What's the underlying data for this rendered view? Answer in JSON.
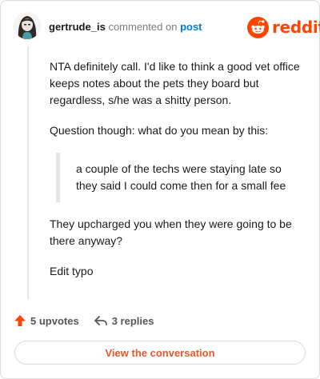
{
  "header": {
    "username": "gertrude_is",
    "commented_on": "commented on",
    "post_link": "post"
  },
  "brand": {
    "name": "reddit",
    "logo_icon": "reddit-alien-icon",
    "color": "#ff4500"
  },
  "comment": {
    "paragraph_1": "NTA definitely call. I'd like to think a good vet office keeps notes about the pets they board but regardless, s/he was a shitty person.",
    "paragraph_2": "Question though: what do you mean by this:",
    "quote": "a couple of the techs were staying late so they said I could come then for a small fee",
    "paragraph_3": "They upcharged you when they were going to be there anyway?",
    "paragraph_4": "Edit typo"
  },
  "footer": {
    "upvotes_label": "5 upvotes",
    "upvote_icon": "upvote-arrow-icon",
    "upvote_color": "#ff4500",
    "replies_label": "3 replies",
    "reply_icon": "reply-arrow-icon"
  },
  "cta": {
    "label": "View the conversation",
    "color": "#e8572a"
  }
}
